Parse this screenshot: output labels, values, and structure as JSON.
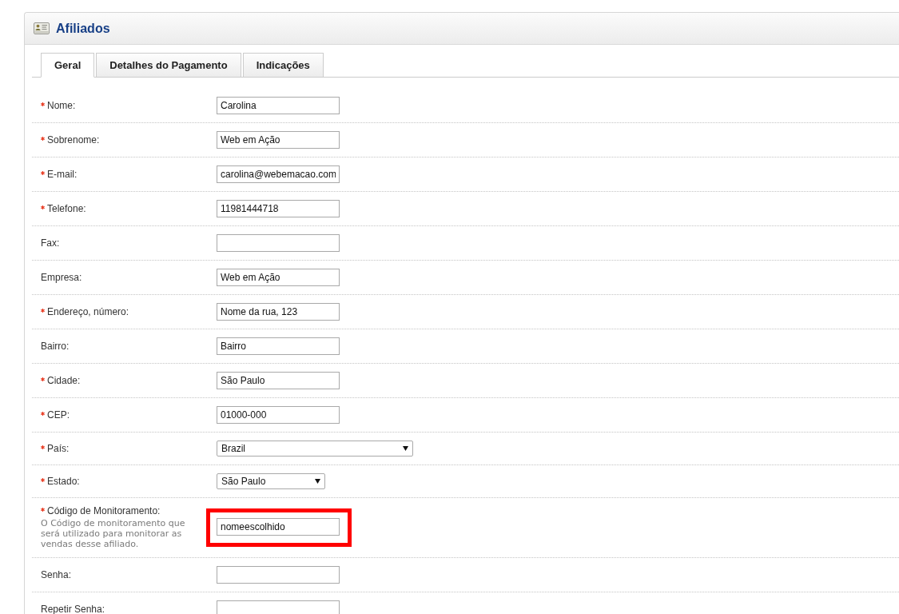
{
  "panel": {
    "title": "Afiliados"
  },
  "tabs": [
    {
      "label": "Geral",
      "selected": true
    },
    {
      "label": "Detalhes do Pagamento",
      "selected": false
    },
    {
      "label": "Indicações",
      "selected": false
    }
  ],
  "fields": [
    {
      "kind": "text",
      "label": "Nome:",
      "required": true,
      "value": "Carolina",
      "highlighted": false
    },
    {
      "kind": "text",
      "label": "Sobrenome:",
      "required": true,
      "value": "Web em Ação",
      "highlighted": false
    },
    {
      "kind": "text",
      "label": "E-mail:",
      "required": true,
      "value": "carolina@webemacao.com",
      "highlighted": false
    },
    {
      "kind": "text",
      "label": "Telefone:",
      "required": true,
      "value": "11981444718",
      "highlighted": false
    },
    {
      "kind": "text",
      "label": "Fax:",
      "required": false,
      "highlighted": false
    },
    {
      "kind": "text",
      "label": "Empresa:",
      "required": false,
      "value": "Web em Ação",
      "highlighted": false
    },
    {
      "kind": "text",
      "label": "Endereço, número:",
      "required": true,
      "value": "Nome da rua, 123",
      "highlighted": false
    },
    {
      "kind": "text",
      "label": "Bairro:",
      "required": false,
      "value": "Bairro",
      "highlighted": false
    },
    {
      "kind": "text",
      "label": "Cidade:",
      "required": true,
      "value": "São Paulo",
      "highlighted": false
    },
    {
      "kind": "text",
      "label": "CEP:",
      "required": true,
      "value": "01000-000",
      "highlighted": false
    },
    {
      "kind": "select",
      "label": "País:",
      "required": true,
      "value": "Brazil",
      "highlighted": false
    },
    {
      "kind": "select",
      "label": "Estado:",
      "required": true,
      "value": "São Paulo",
      "highlighted": false
    },
    {
      "kind": "text",
      "label": "Código de Monitoramento:",
      "required": true,
      "hint": "O Código de monitoramento que será utilizado para monitorar as vendas desse afiliado.",
      "value": "nomeescolhido",
      "highlighted": true
    },
    {
      "kind": "text",
      "label": "Senha:",
      "required": false,
      "highlighted": false
    },
    {
      "kind": "text",
      "label": "Repetir Senha:",
      "required": false,
      "highlighted": false
    }
  ]
}
